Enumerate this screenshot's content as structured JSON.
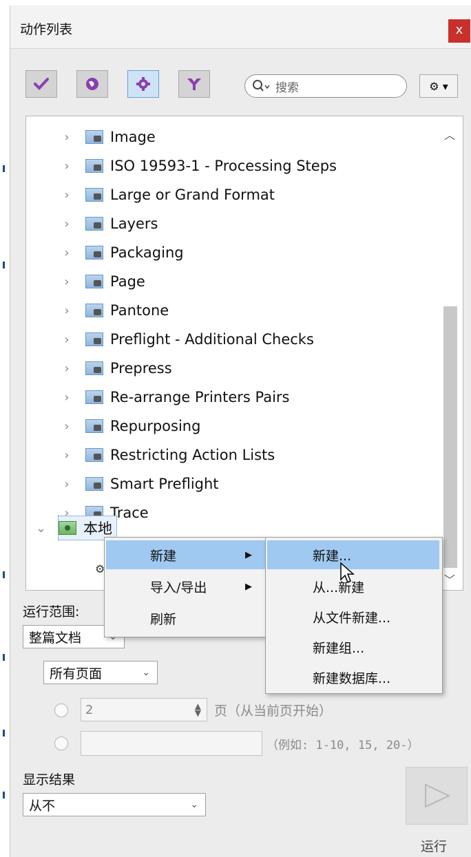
{
  "window": {
    "title": "动作列表",
    "close_label": "x"
  },
  "toolbar": {
    "buttons": [
      {
        "name": "checkmark-icon"
      },
      {
        "name": "globe-icon"
      },
      {
        "name": "gear-icon",
        "active": true
      },
      {
        "name": "filter-icon"
      }
    ],
    "search_placeholder": "搜索",
    "options_label": "⚙ ▾"
  },
  "tree": {
    "items": [
      "Image",
      "ISO 19593-1 - Processing Steps",
      "Large or Grand Format",
      "Layers",
      "Packaging",
      "Page",
      "Pantone",
      "Preflight - Additional Checks",
      "Prepress",
      "Re-arrange Printers Pairs",
      "Repurposing",
      "Restricting Action Lists",
      "Smart Preflight",
      "Trace"
    ],
    "local_label": "本地"
  },
  "options": {
    "run_scope_label": "运行范围:",
    "scope_value": "整篇文档",
    "pages_value": "所有页面",
    "page_number": "2",
    "page_suffix": "页（从当前页开始）",
    "range_hint": "（例如: 1-10, 15, 20-）",
    "show_results_label": "显示结果",
    "show_results_value": "从不",
    "run_label": "运行"
  },
  "context_menu": {
    "items": [
      "新建",
      "导入/导出",
      "刷新"
    ],
    "submenu": [
      "新建...",
      "从...新建",
      "从文件新建...",
      "新建组...",
      "新建数据库..."
    ]
  },
  "colors": {
    "accent_purple": "#7b3fa0",
    "highlight_blue": "#9fc9f0",
    "close_red": "#c9302c"
  }
}
